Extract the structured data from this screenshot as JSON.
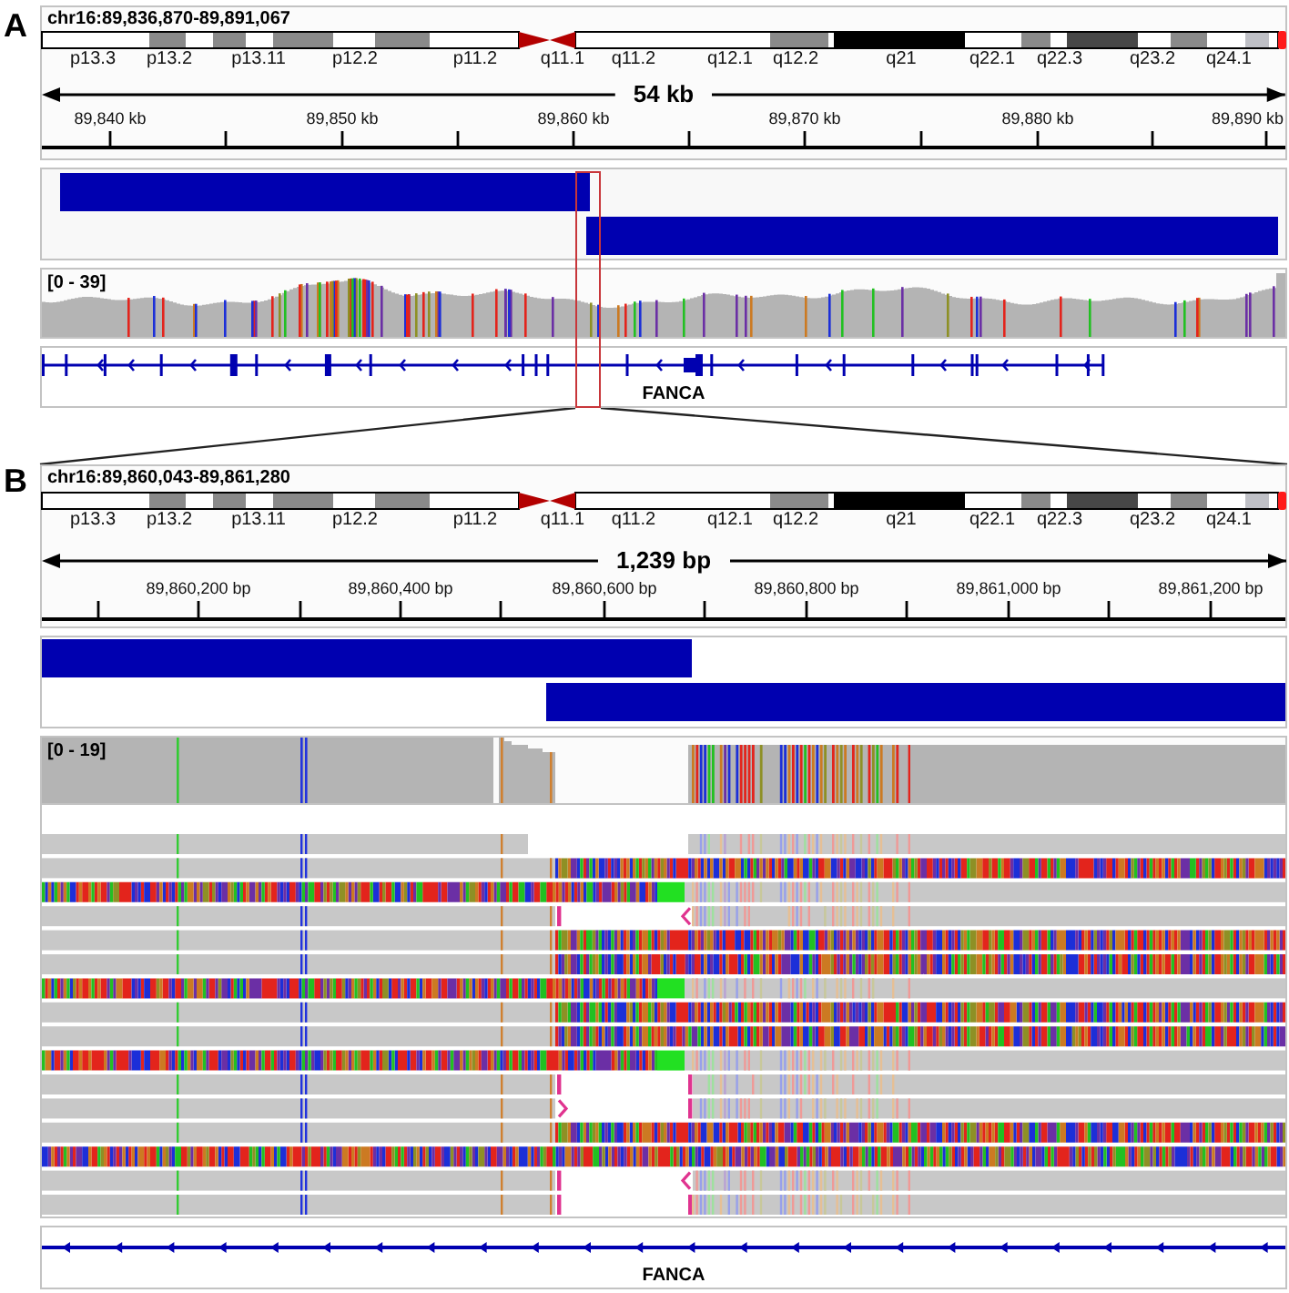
{
  "panels": [
    {
      "label": "A",
      "locus": "chr16:89,836,870-89,891,067",
      "region_highlight": true,
      "ideogram": {
        "bands": [
          "p13.3",
          "p13.2",
          "p13.11",
          "p12.2",
          "p11.2",
          "q11.1",
          "q11.2",
          "q12.1",
          "q12.2",
          "q21",
          "q22.1",
          "q22.3",
          "q23.2",
          "q24.1"
        ]
      },
      "ruler": {
        "span": "54 kb",
        "ticks": [
          "89,840 kb",
          "89,850 kb",
          "89,860 kb",
          "89,870 kb",
          "89,880 kb",
          "89,890 kb"
        ]
      },
      "tracks": [
        {
          "kind": "features"
        },
        {
          "kind": "coverage",
          "range": "[0 - 39]"
        },
        {
          "kind": "gene",
          "name": "FANCA"
        }
      ]
    },
    {
      "label": "B",
      "locus": "chr16:89,860,043-89,861,280",
      "ideogram": {
        "bands": [
          "p13.3",
          "p13.2",
          "p13.11",
          "p12.2",
          "p11.2",
          "q11.1",
          "q11.2",
          "q12.1",
          "q12.2",
          "q21",
          "q22.1",
          "q22.3",
          "q23.2",
          "q24.1"
        ]
      },
      "ruler": {
        "span": "1,239 bp",
        "ticks": [
          "89,860,200 bp",
          "89,860,400 bp",
          "89,860,600 bp",
          "89,860,800 bp",
          "89,861,000 bp",
          "89,861,200 bp"
        ]
      },
      "tracks": [
        {
          "kind": "features"
        },
        {
          "kind": "coverage",
          "range": "[0 - 19]"
        },
        {
          "kind": "alignments",
          "reads": [
            {
              "kind": "gapped"
            },
            {
              "kind": "clipped-right"
            },
            {
              "kind": "clipped-left"
            },
            {
              "kind": "split-left"
            },
            {
              "kind": "clipped-right"
            },
            {
              "kind": "clipped-right"
            },
            {
              "kind": "clipped-left"
            },
            {
              "kind": "clipped-right"
            },
            {
              "kind": "clipped-right"
            },
            {
              "kind": "clipped-left"
            },
            {
              "kind": "deletion"
            },
            {
              "kind": "split-right"
            },
            {
              "kind": "clipped-right"
            },
            {
              "kind": "mismatched"
            },
            {
              "kind": "split-left"
            },
            {
              "kind": "deletion"
            }
          ]
        },
        {
          "kind": "gene",
          "name": "FANCA"
        }
      ]
    }
  ]
}
